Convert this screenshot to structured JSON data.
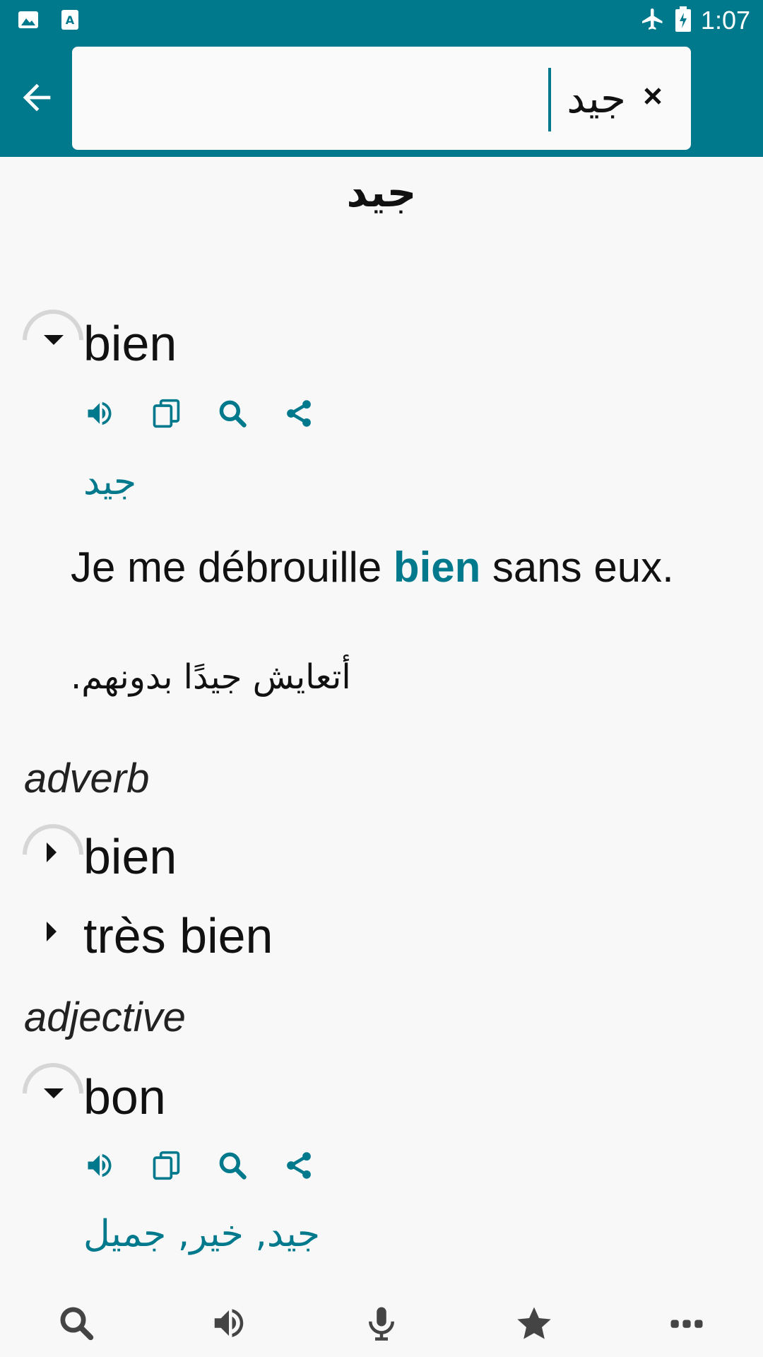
{
  "status_bar": {
    "time": "1:07"
  },
  "search": {
    "value": "جيد"
  },
  "headword": "جيد",
  "entries": [
    {
      "term": "bien",
      "expanded": true,
      "translation": "جيد",
      "example_before": "Je me débrouille ",
      "example_highlight": "bien",
      "example_after": " sans eux.",
      "example_translation": "أتعايش جيدًا بدونهم."
    }
  ],
  "sections": [
    {
      "pos": "adverb",
      "terms": [
        "bien",
        "très bien"
      ]
    },
    {
      "pos": "adjective",
      "term": "bon",
      "translation": "جيد, خير, جميل"
    }
  ],
  "icons": {
    "actions": [
      "speaker-icon",
      "copy-icon",
      "search-icon",
      "share-icon"
    ],
    "bottom_nav": [
      "search-icon",
      "speaker-icon",
      "microphone-icon",
      "star-icon",
      "more-icon"
    ]
  },
  "colors": {
    "accent": "#00798c",
    "background": "#f8f8f8",
    "icon": "#444444"
  }
}
